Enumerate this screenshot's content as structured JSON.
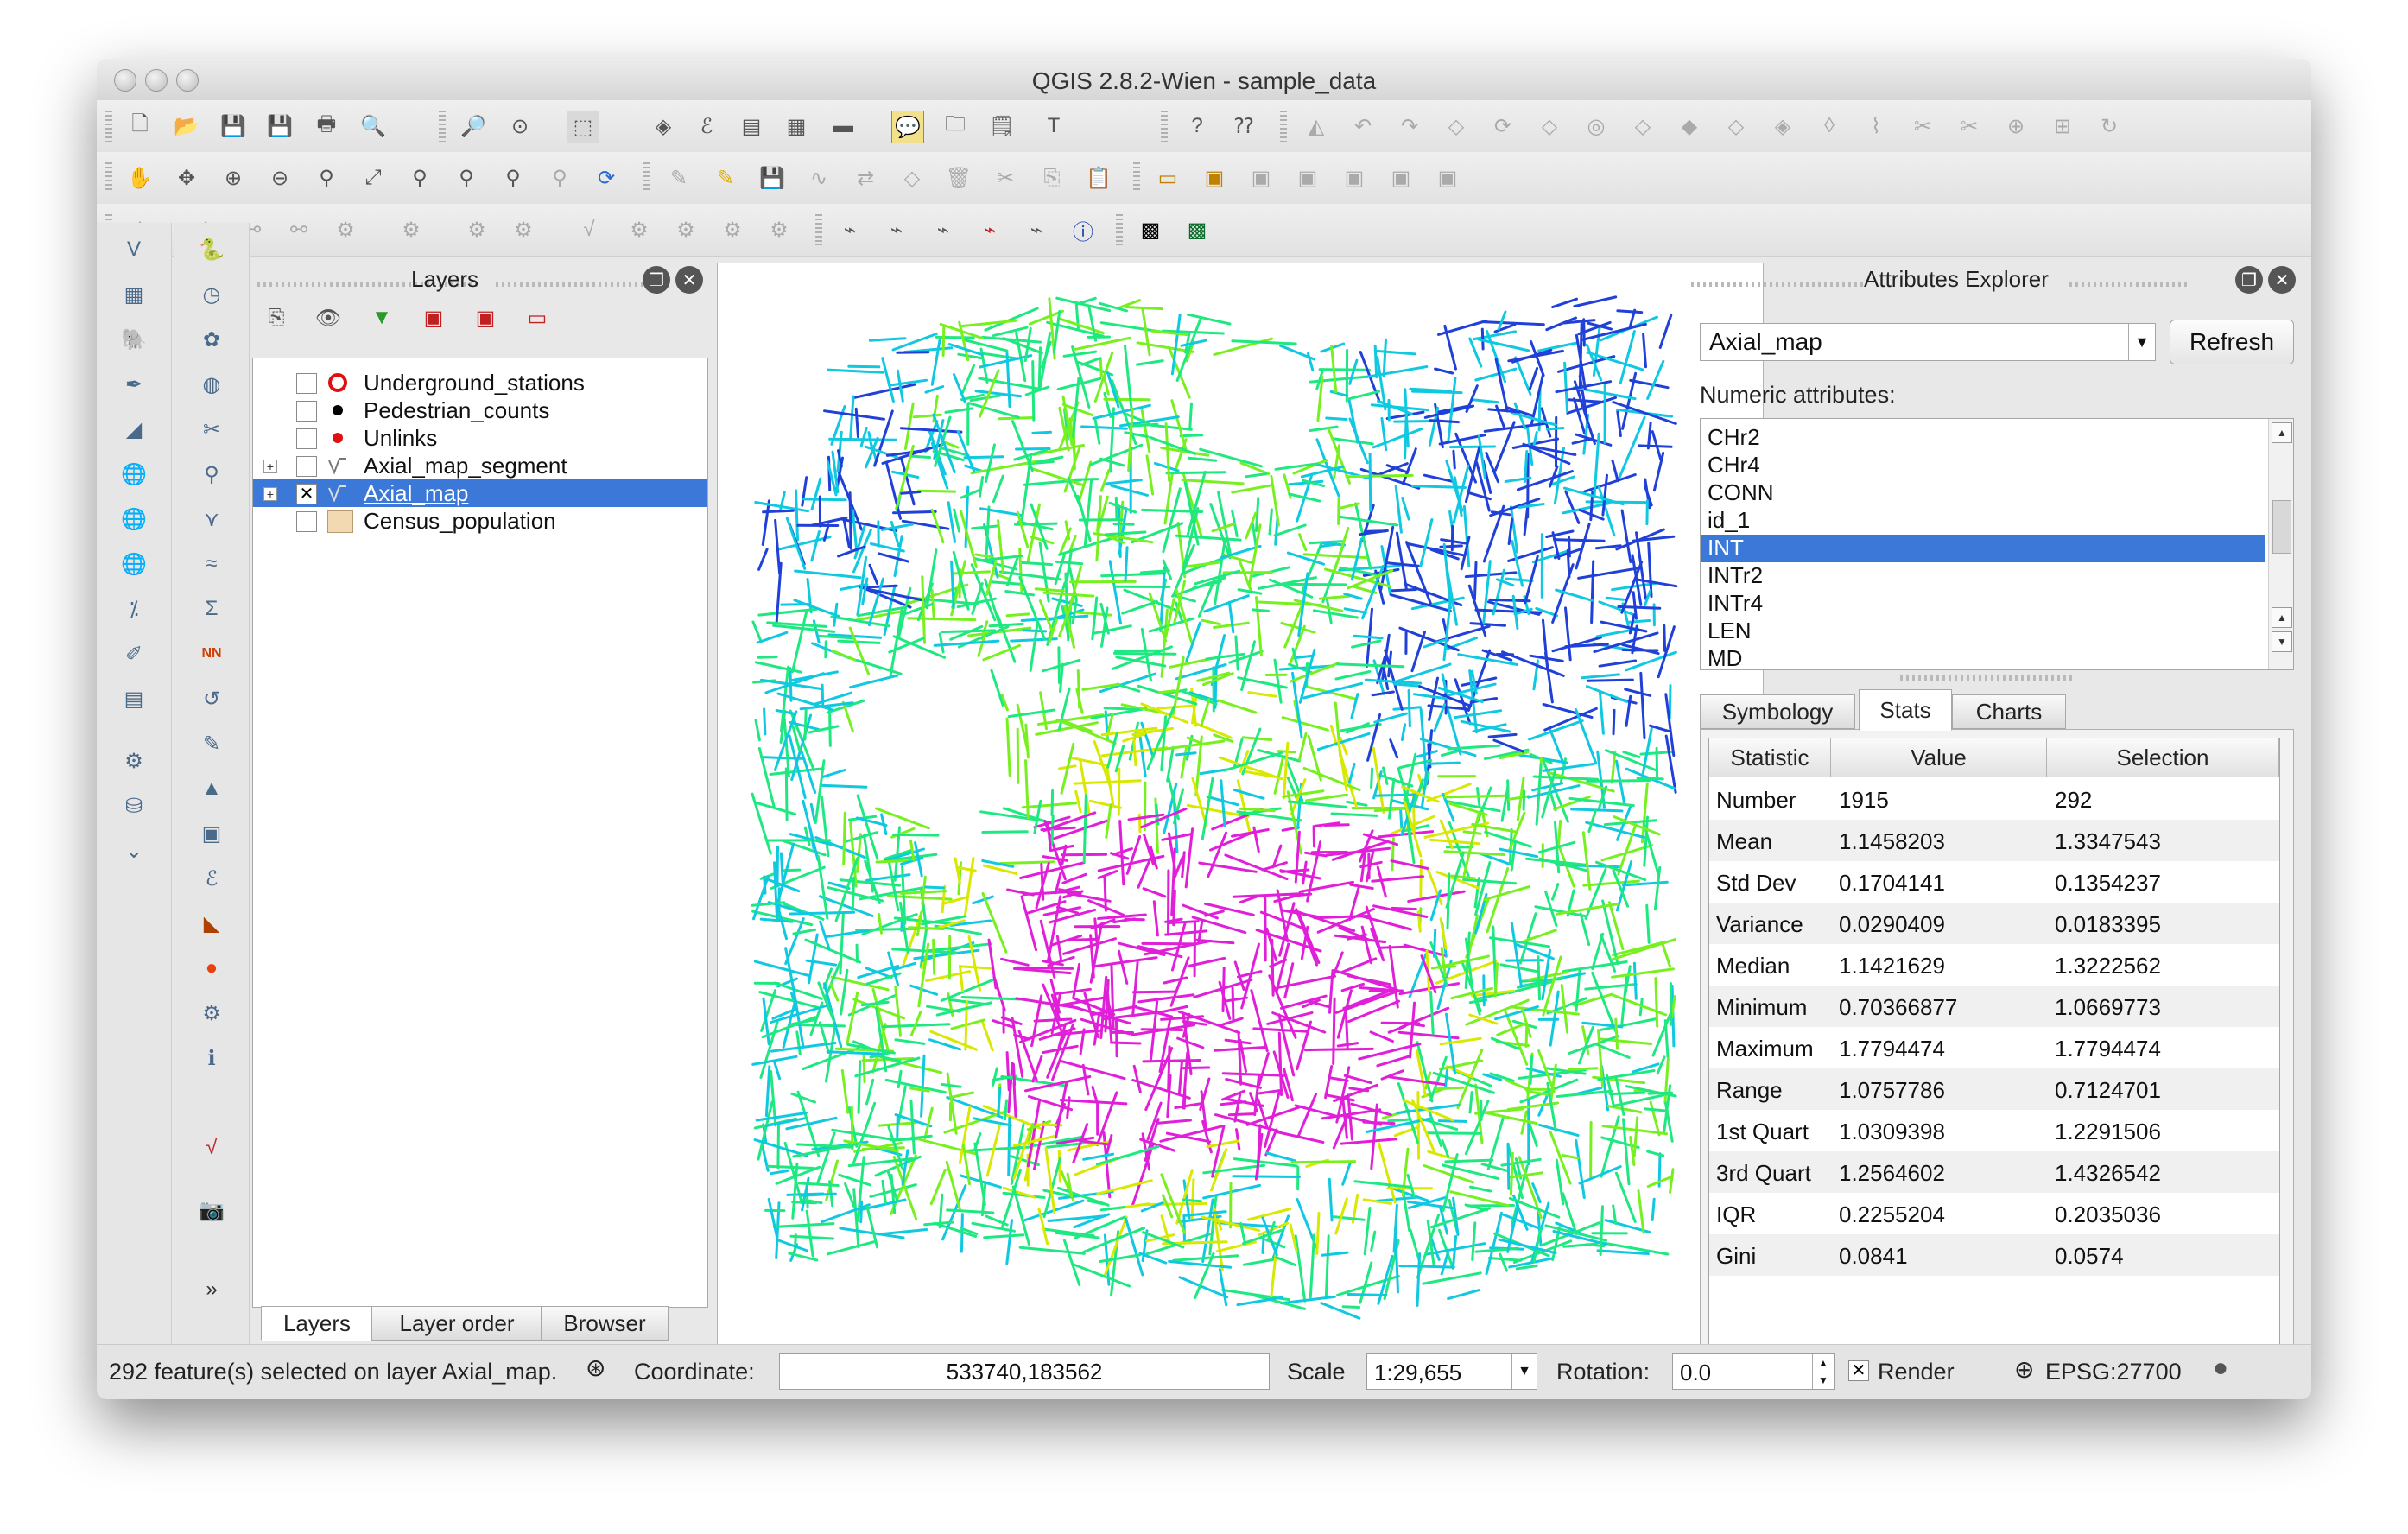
{
  "window": {
    "title": "QGIS 2.8.2-Wien - sample_data"
  },
  "layers_panel": {
    "title": "Layers",
    "layers": [
      {
        "name": "Underground_stations",
        "checked": false,
        "symbol": "ring-red"
      },
      {
        "name": "Pedestrian_counts",
        "checked": false,
        "symbol": "dot-black"
      },
      {
        "name": "Unlinks",
        "checked": false,
        "symbol": "dot-red"
      },
      {
        "name": "Axial_map_segment",
        "checked": false,
        "symbol": "line",
        "expandable": true
      },
      {
        "name": "Axial_map",
        "checked": true,
        "symbol": "line",
        "expandable": true,
        "selected": true
      },
      {
        "name": "Census_population",
        "checked": false,
        "symbol": "fill-tan"
      }
    ],
    "tabs": [
      "Layers",
      "Layer order",
      "Browser"
    ]
  },
  "attributes_explorer": {
    "title": "Attributes Explorer",
    "layer_combo": "Axial_map",
    "refresh_label": "Refresh",
    "numeric_label": "Numeric attributes:",
    "attributes": [
      "CHr2",
      "CHr4",
      "CONN",
      "id_1",
      "INT",
      "INTr2",
      "INTr4",
      "LEN",
      "MD"
    ],
    "selected_attribute": "INT",
    "tabs": [
      "Symbology",
      "Stats",
      "Charts"
    ],
    "active_tab": "Stats",
    "stats": {
      "headers": [
        "Statistic",
        "Value",
        "Selection"
      ],
      "rows": [
        [
          "Number",
          "1915",
          "292"
        ],
        [
          "Mean",
          "1.1458203",
          "1.3347543"
        ],
        [
          "Std Dev",
          "0.1704141",
          "0.1354237"
        ],
        [
          "Variance",
          "0.0290409",
          "0.0183395"
        ],
        [
          "Median",
          "1.1421629",
          "1.3222562"
        ],
        [
          "Minimum",
          "0.70366877",
          "1.0669773"
        ],
        [
          "Maximum",
          "1.7794474",
          "1.7794474"
        ],
        [
          "Range",
          "1.0757786",
          "0.7124701"
        ],
        [
          "1st Quart",
          "1.0309398",
          "1.2291506"
        ],
        [
          "3rd Quart",
          "1.2564602",
          "1.4326542"
        ],
        [
          "IQR",
          "0.2255204",
          "0.2035036"
        ],
        [
          "Gini",
          "0.0841",
          "0.0574"
        ]
      ]
    }
  },
  "statusbar": {
    "message": "292 feature(s) selected on layer Axial_map.",
    "coordinate_label": "Coordinate:",
    "coordinate_value": "533740,183562",
    "scale_label": "Scale",
    "scale_value": "1:29,655",
    "rotation_label": "Rotation:",
    "rotation_value": "0.0",
    "render_label": "Render",
    "render_checked": true,
    "crs": "EPSG:27700"
  },
  "map_colors": [
    "#2040d8",
    "#10c8e0",
    "#20e880",
    "#78f020",
    "#d8e800",
    "#e020d8"
  ]
}
